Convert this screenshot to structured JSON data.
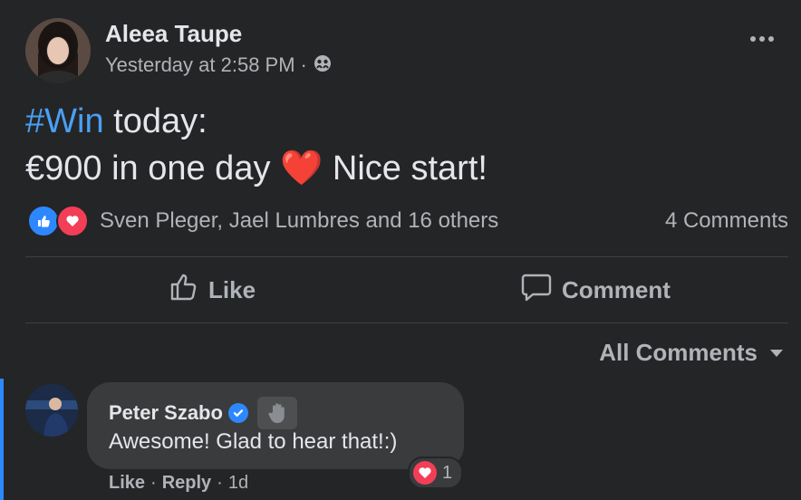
{
  "post": {
    "author": "Aleea Taupe",
    "timestamp": "Yesterday at 2:58 PM",
    "separator": "·",
    "audience_icon": "friends-icon",
    "hashtag": "#Win",
    "line1_rest": " today:",
    "line2_before": "€900 in one day ",
    "line2_emoji": "❤️",
    "line2_after": " Nice start!",
    "reactions_text": "Sven Pleger, Jael Lumbres and 16 others",
    "comments_count": "4 Comments"
  },
  "actions": {
    "like": "Like",
    "comment": "Comment"
  },
  "filter": {
    "label": "All Comments"
  },
  "comment": {
    "author": "Peter Szabo",
    "text": "Awesome! Glad to hear that!:)",
    "reaction_count": "1",
    "like": "Like",
    "reply": "Reply",
    "age": "1d",
    "sep": "·"
  },
  "colors": {
    "background": "#242526",
    "accent": "#2d88ff",
    "hashtag": "#4a9ff5",
    "love": "#f33e58"
  }
}
